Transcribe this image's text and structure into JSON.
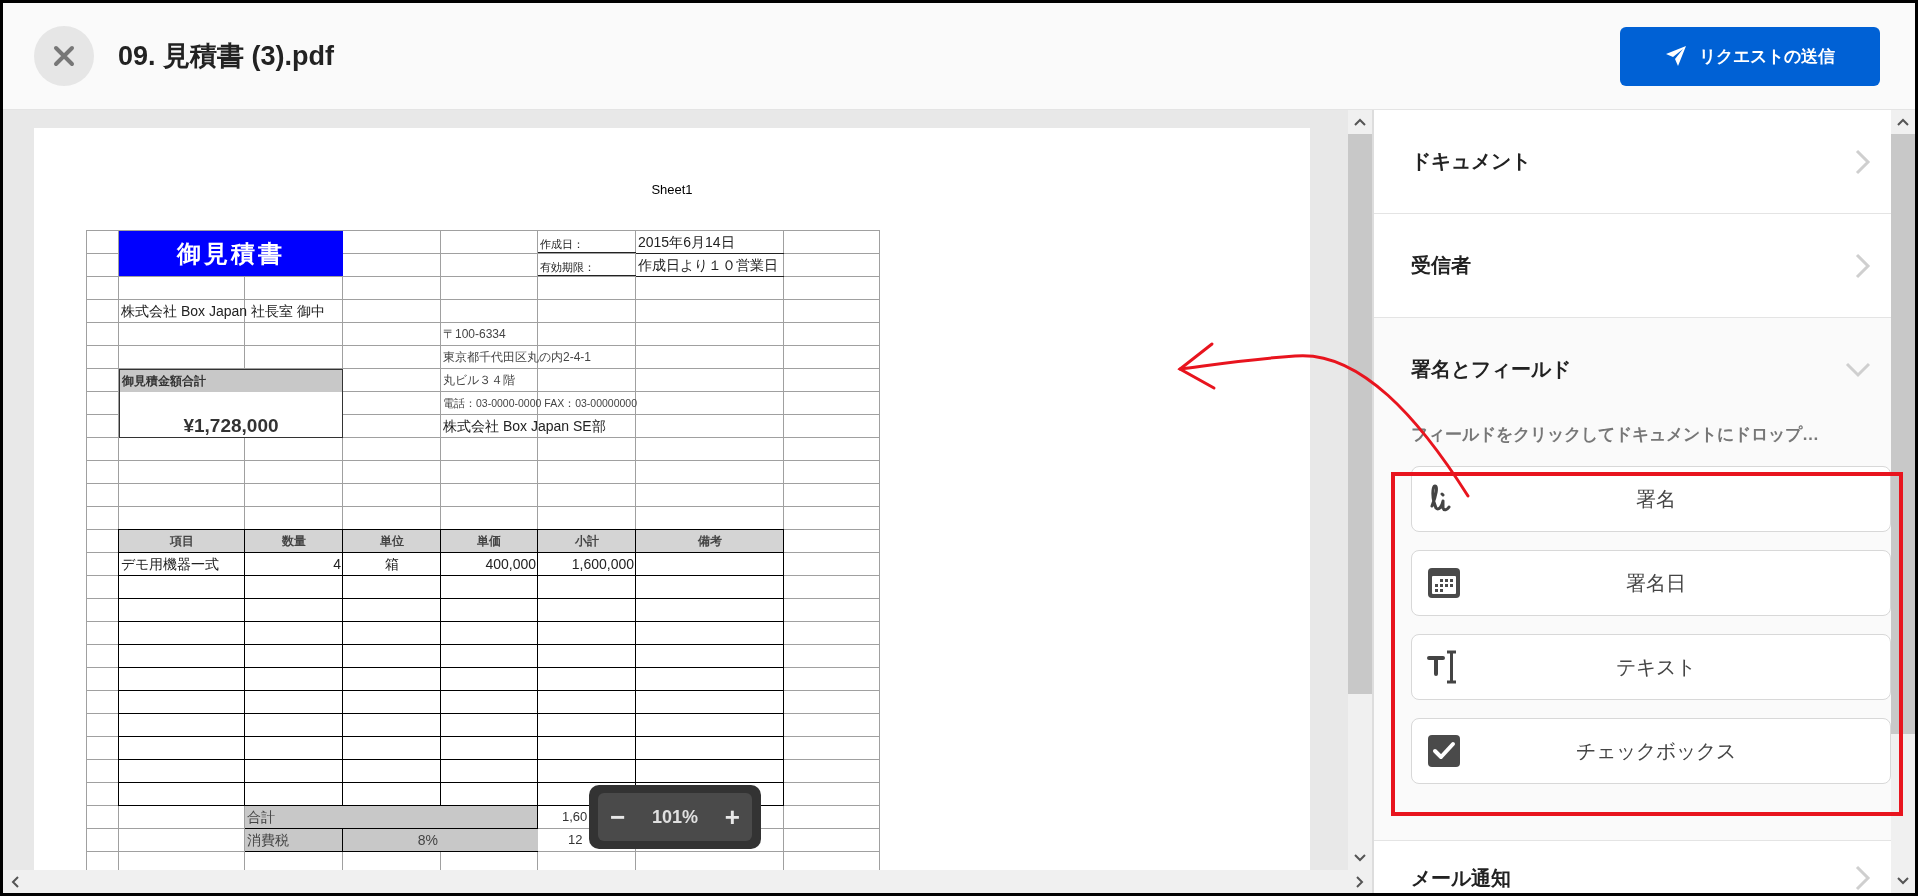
{
  "header": {
    "title": "09. 見積書 (3).pdf",
    "send_button": "リクエストの送信"
  },
  "document": {
    "sheet_title": "Sheet1",
    "quote_title": "御見積書",
    "created_label": "作成日：",
    "created_date": "2015年6月14日",
    "valid_label": "有効期限：",
    "valid_value": "作成日より１０営業日",
    "addressee": "株式会社 Box Japan 社長室 御中",
    "sender_lines": [
      {
        "text": "〒100-6334",
        "kind": "address"
      },
      {
        "text": "東京都千代田区丸の内2-4-1",
        "kind": "address"
      },
      {
        "text": "丸ビル３４階",
        "kind": "address"
      },
      {
        "text": "電話：03-0000-0000 FAX：03-00000000",
        "kind": "phone"
      },
      {
        "text": "株式会社 Box Japan SE部",
        "kind": "company"
      }
    ],
    "total_label": "御見積金額合計",
    "total_amount": "¥1,728,000",
    "items_table": {
      "columns": [
        "項目",
        "数量",
        "単位",
        "単価",
        "小計",
        "備考"
      ],
      "rows": [
        [
          "デモ用機器一式",
          "4",
          "箱",
          "400,000",
          "1,600,000"
        ]
      ]
    },
    "summary": [
      {
        "label": "合計",
        "value": "1,60"
      },
      {
        "label": "消費税",
        "rate": "8%",
        "value": "12"
      }
    ]
  },
  "zoom_control": {
    "minus": "−",
    "value": "101%",
    "plus": "+"
  },
  "panel": {
    "sections": [
      {
        "title": "ドキュメント",
        "expanded": false
      },
      {
        "title": "受信者",
        "expanded": false
      },
      {
        "title": "署名とフィールド",
        "expanded": true,
        "hint": "フィールドをクリックしてドキュメントにドロップ…",
        "fields": [
          {
            "label": "署名",
            "kind": "signature"
          },
          {
            "label": "署名日",
            "kind": "date"
          },
          {
            "label": "テキスト",
            "kind": "text"
          },
          {
            "label": "チェックボックス",
            "kind": "checkbox"
          }
        ]
      },
      {
        "title": "メール通知",
        "expanded": false
      }
    ]
  }
}
